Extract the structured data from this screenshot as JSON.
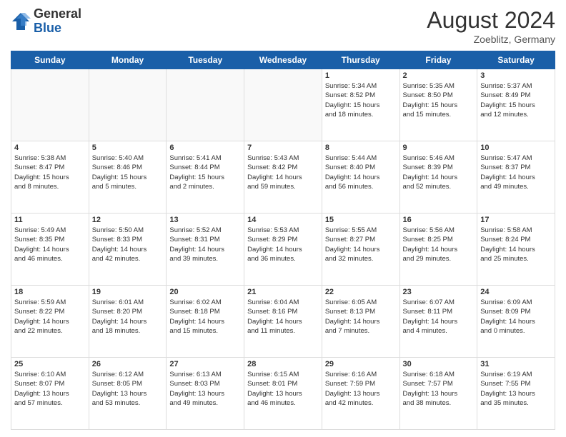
{
  "header": {
    "logo_general": "General",
    "logo_blue": "Blue",
    "month_year": "August 2024",
    "location": "Zoeblitz, Germany"
  },
  "weekdays": [
    "Sunday",
    "Monday",
    "Tuesday",
    "Wednesday",
    "Thursday",
    "Friday",
    "Saturday"
  ],
  "weeks": [
    [
      {
        "day": "",
        "info": ""
      },
      {
        "day": "",
        "info": ""
      },
      {
        "day": "",
        "info": ""
      },
      {
        "day": "",
        "info": ""
      },
      {
        "day": "1",
        "info": "Sunrise: 5:34 AM\nSunset: 8:52 PM\nDaylight: 15 hours\nand 18 minutes."
      },
      {
        "day": "2",
        "info": "Sunrise: 5:35 AM\nSunset: 8:50 PM\nDaylight: 15 hours\nand 15 minutes."
      },
      {
        "day": "3",
        "info": "Sunrise: 5:37 AM\nSunset: 8:49 PM\nDaylight: 15 hours\nand 12 minutes."
      }
    ],
    [
      {
        "day": "4",
        "info": "Sunrise: 5:38 AM\nSunset: 8:47 PM\nDaylight: 15 hours\nand 8 minutes."
      },
      {
        "day": "5",
        "info": "Sunrise: 5:40 AM\nSunset: 8:46 PM\nDaylight: 15 hours\nand 5 minutes."
      },
      {
        "day": "6",
        "info": "Sunrise: 5:41 AM\nSunset: 8:44 PM\nDaylight: 15 hours\nand 2 minutes."
      },
      {
        "day": "7",
        "info": "Sunrise: 5:43 AM\nSunset: 8:42 PM\nDaylight: 14 hours\nand 59 minutes."
      },
      {
        "day": "8",
        "info": "Sunrise: 5:44 AM\nSunset: 8:40 PM\nDaylight: 14 hours\nand 56 minutes."
      },
      {
        "day": "9",
        "info": "Sunrise: 5:46 AM\nSunset: 8:39 PM\nDaylight: 14 hours\nand 52 minutes."
      },
      {
        "day": "10",
        "info": "Sunrise: 5:47 AM\nSunset: 8:37 PM\nDaylight: 14 hours\nand 49 minutes."
      }
    ],
    [
      {
        "day": "11",
        "info": "Sunrise: 5:49 AM\nSunset: 8:35 PM\nDaylight: 14 hours\nand 46 minutes."
      },
      {
        "day": "12",
        "info": "Sunrise: 5:50 AM\nSunset: 8:33 PM\nDaylight: 14 hours\nand 42 minutes."
      },
      {
        "day": "13",
        "info": "Sunrise: 5:52 AM\nSunset: 8:31 PM\nDaylight: 14 hours\nand 39 minutes."
      },
      {
        "day": "14",
        "info": "Sunrise: 5:53 AM\nSunset: 8:29 PM\nDaylight: 14 hours\nand 36 minutes."
      },
      {
        "day": "15",
        "info": "Sunrise: 5:55 AM\nSunset: 8:27 PM\nDaylight: 14 hours\nand 32 minutes."
      },
      {
        "day": "16",
        "info": "Sunrise: 5:56 AM\nSunset: 8:25 PM\nDaylight: 14 hours\nand 29 minutes."
      },
      {
        "day": "17",
        "info": "Sunrise: 5:58 AM\nSunset: 8:24 PM\nDaylight: 14 hours\nand 25 minutes."
      }
    ],
    [
      {
        "day": "18",
        "info": "Sunrise: 5:59 AM\nSunset: 8:22 PM\nDaylight: 14 hours\nand 22 minutes."
      },
      {
        "day": "19",
        "info": "Sunrise: 6:01 AM\nSunset: 8:20 PM\nDaylight: 14 hours\nand 18 minutes."
      },
      {
        "day": "20",
        "info": "Sunrise: 6:02 AM\nSunset: 8:18 PM\nDaylight: 14 hours\nand 15 minutes."
      },
      {
        "day": "21",
        "info": "Sunrise: 6:04 AM\nSunset: 8:16 PM\nDaylight: 14 hours\nand 11 minutes."
      },
      {
        "day": "22",
        "info": "Sunrise: 6:05 AM\nSunset: 8:13 PM\nDaylight: 14 hours\nand 7 minutes."
      },
      {
        "day": "23",
        "info": "Sunrise: 6:07 AM\nSunset: 8:11 PM\nDaylight: 14 hours\nand 4 minutes."
      },
      {
        "day": "24",
        "info": "Sunrise: 6:09 AM\nSunset: 8:09 PM\nDaylight: 14 hours\nand 0 minutes."
      }
    ],
    [
      {
        "day": "25",
        "info": "Sunrise: 6:10 AM\nSunset: 8:07 PM\nDaylight: 13 hours\nand 57 minutes."
      },
      {
        "day": "26",
        "info": "Sunrise: 6:12 AM\nSunset: 8:05 PM\nDaylight: 13 hours\nand 53 minutes."
      },
      {
        "day": "27",
        "info": "Sunrise: 6:13 AM\nSunset: 8:03 PM\nDaylight: 13 hours\nand 49 minutes."
      },
      {
        "day": "28",
        "info": "Sunrise: 6:15 AM\nSunset: 8:01 PM\nDaylight: 13 hours\nand 46 minutes."
      },
      {
        "day": "29",
        "info": "Sunrise: 6:16 AM\nSunset: 7:59 PM\nDaylight: 13 hours\nand 42 minutes."
      },
      {
        "day": "30",
        "info": "Sunrise: 6:18 AM\nSunset: 7:57 PM\nDaylight: 13 hours\nand 38 minutes."
      },
      {
        "day": "31",
        "info": "Sunrise: 6:19 AM\nSunset: 7:55 PM\nDaylight: 13 hours\nand 35 minutes."
      }
    ]
  ]
}
